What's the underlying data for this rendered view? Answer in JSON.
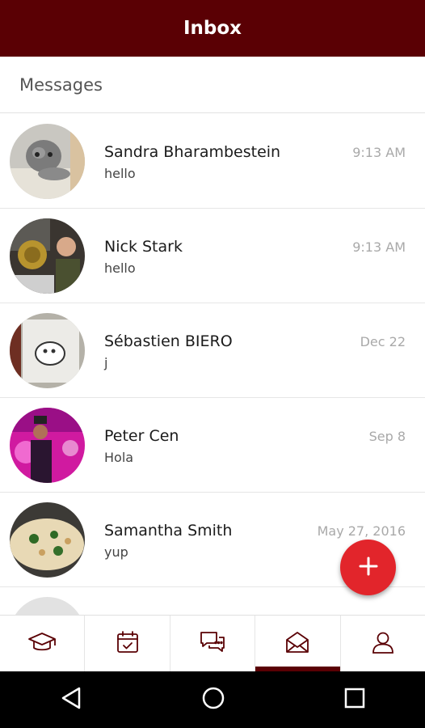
{
  "header": {
    "title": "Inbox",
    "color": "#5a0004"
  },
  "section": {
    "label": "Messages"
  },
  "conversations": [
    {
      "name": "Sandra Bharambestein",
      "message": "hello",
      "time": "9:13 AM",
      "avatar": "kitten-photo"
    },
    {
      "name": "Nick Stark",
      "message": "hello",
      "time": "9:13 AM",
      "avatar": "man-with-equipment-photo"
    },
    {
      "name": "Sébastien BIERO",
      "message": "j",
      "time": "Dec 22",
      "avatar": "ghost-sign-photo"
    },
    {
      "name": "Peter Cen",
      "message": "Hola",
      "time": "Sep 8",
      "avatar": "pink-stage-photo"
    },
    {
      "name": "Samantha Smith",
      "message": "yup",
      "time": "May 27, 2016",
      "avatar": "pizza-photo"
    }
  ],
  "fab": {
    "icon": "plus-icon",
    "color": "#e2252b"
  },
  "tabs": [
    {
      "id": "courses",
      "icon": "graduation-cap-icon",
      "active": false
    },
    {
      "id": "calendar",
      "icon": "calendar-check-icon",
      "active": false
    },
    {
      "id": "chat",
      "icon": "chat-bubbles-icon",
      "active": false
    },
    {
      "id": "inbox",
      "icon": "envelope-icon",
      "active": true
    },
    {
      "id": "profile",
      "icon": "person-icon",
      "active": false
    }
  ],
  "system_nav": [
    "back-icon",
    "home-icon",
    "recents-icon"
  ]
}
